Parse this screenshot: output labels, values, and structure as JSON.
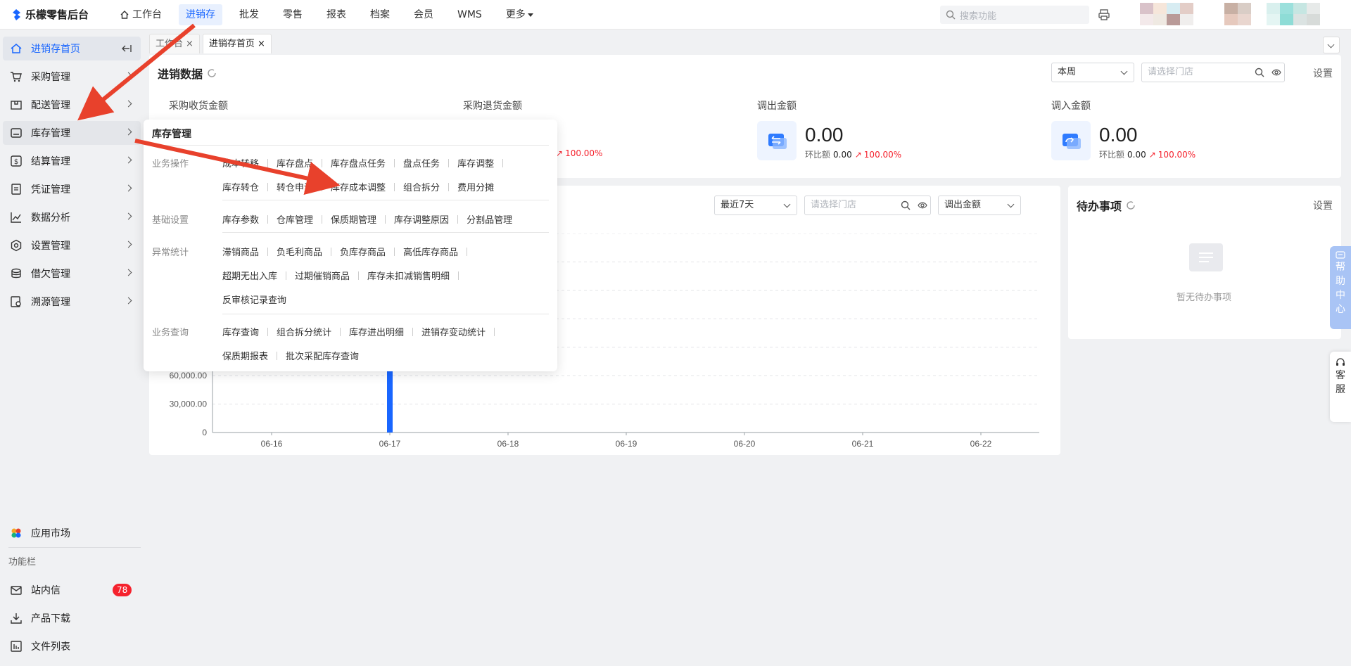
{
  "app": {
    "title": "乐檬零售后台"
  },
  "topnav": {
    "items": [
      {
        "label": "工作台"
      },
      {
        "label": "进销存"
      },
      {
        "label": "批发"
      },
      {
        "label": "零售"
      },
      {
        "label": "报表"
      },
      {
        "label": "档案"
      },
      {
        "label": "会员"
      },
      {
        "label": "WMS"
      },
      {
        "label": "更多"
      }
    ],
    "search_placeholder": "搜索功能"
  },
  "sidebar": {
    "items": [
      {
        "label": "进销存首页"
      },
      {
        "label": "采购管理"
      },
      {
        "label": "配送管理"
      },
      {
        "label": "库存管理"
      },
      {
        "label": "结算管理"
      },
      {
        "label": "凭证管理"
      },
      {
        "label": "数据分析"
      },
      {
        "label": "设置管理"
      },
      {
        "label": "借欠管理"
      },
      {
        "label": "溯源管理"
      }
    ],
    "app_market": "应用市场",
    "section_label": "功能栏",
    "bottom": [
      {
        "label": "站内信",
        "badge": "78"
      },
      {
        "label": "产品下载"
      },
      {
        "label": "文件列表"
      }
    ]
  },
  "tabs": [
    {
      "label": "工作台"
    },
    {
      "label": "进销存首页"
    }
  ],
  "overview": {
    "title": "进销数据",
    "period": "本周",
    "store_placeholder": "请选择门店",
    "settings": "设置",
    "metrics": [
      {
        "label": "采购收货金额"
      },
      {
        "label": "采购退货金额",
        "ratio_pct": "100.00%"
      },
      {
        "label": "调出金额",
        "value": "0.00",
        "ratio_label": "环比额",
        "ratio_value": "0.00",
        "ratio_pct": "100.00%"
      },
      {
        "label": "调入金额",
        "value": "0.00",
        "ratio_label": "环比额",
        "ratio_value": "0.00",
        "ratio_pct": "100.00%"
      }
    ]
  },
  "trend": {
    "range": "最近7天",
    "store_placeholder": "请选择门店",
    "metric": "调出金额"
  },
  "chart_data": {
    "type": "bar",
    "categories": [
      "06-16",
      "06-17",
      "06-18",
      "06-19",
      "06-20",
      "06-21",
      "06-22"
    ],
    "values": [
      0,
      180000,
      0,
      0,
      0,
      0,
      0
    ],
    "y_ticks": [
      "0",
      "30,000.00",
      "60,000.00"
    ],
    "ylim": [
      0,
      210000
    ],
    "grid": true
  },
  "todo": {
    "title": "待办事项",
    "settings": "设置",
    "empty": "暂无待办事项"
  },
  "float": {
    "help": [
      "帮",
      "助",
      "中",
      "心"
    ],
    "service": [
      "客",
      "服"
    ]
  },
  "popup": {
    "title": "库存管理",
    "groups": [
      {
        "label": "业务操作",
        "rows": [
          [
            "成本转移",
            "库存盘点",
            "库存盘点任务",
            "盘点任务",
            "库存调整"
          ],
          [
            "库存转仓",
            "转仓申请",
            "库存成本调整",
            "组合拆分",
            "费用分摊"
          ]
        ]
      },
      {
        "label": "基础设置",
        "rows": [
          [
            "库存参数",
            "仓库管理",
            "保质期管理",
            "库存调整原因",
            "分割品管理"
          ]
        ]
      },
      {
        "label": "异常统计",
        "rows": [
          [
            "滞销商品",
            "负毛利商品",
            "负库存商品",
            "高低库存商品"
          ],
          [
            "超期无出入库",
            "过期催销商品",
            "库存未扣减销售明细"
          ],
          [
            "反审核记录查询"
          ]
        ]
      },
      {
        "label": "业务查询",
        "rows": [
          [
            "库存查询",
            "组合拆分统计",
            "库存进出明细",
            "进销存变动统计"
          ],
          [
            "保质期报表",
            "批次采配库存查询"
          ]
        ]
      }
    ]
  },
  "colors": {
    "primary": "#1966ff",
    "danger": "#f5222d",
    "arrow": "#e8412c"
  }
}
